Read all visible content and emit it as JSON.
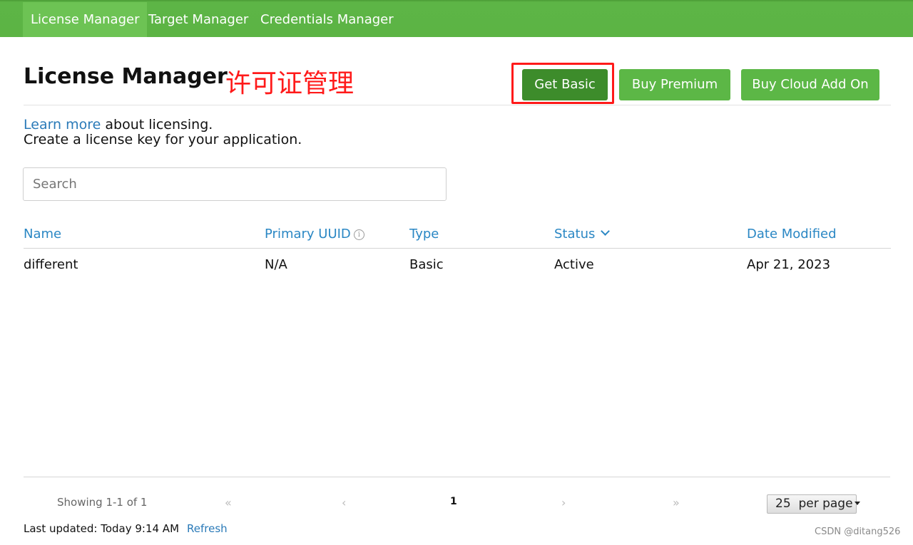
{
  "nav": {
    "tabs": [
      {
        "label": "License Manager",
        "active": true
      },
      {
        "label": "Target Manager",
        "active": false
      },
      {
        "label": "Credentials Manager",
        "active": false
      }
    ]
  },
  "header": {
    "title": "License Manager",
    "annotation": "许可证管理",
    "buttons": {
      "get_basic": "Get Basic",
      "buy_premium": "Buy Premium",
      "buy_cloud_add_on": "Buy Cloud Add On"
    }
  },
  "intro": {
    "learn_more_link": "Learn more",
    "learn_more_suffix": " about licensing.",
    "line2": "Create a license key for your application."
  },
  "search": {
    "placeholder": "Search",
    "value": ""
  },
  "table": {
    "columns": [
      {
        "label": "Name"
      },
      {
        "label": "Primary UUID",
        "icon": "info-icon"
      },
      {
        "label": "Type"
      },
      {
        "label": "Status",
        "icon": "chevron-down-icon",
        "sorted": "desc"
      },
      {
        "label": "Date Modified"
      }
    ],
    "rows": [
      [
        "different",
        "N/A",
        "Basic",
        "Active",
        "Apr 21, 2023"
      ]
    ]
  },
  "pagination": {
    "showing": "Showing 1-1 of 1",
    "first": "«",
    "prev": "‹",
    "current_page": "1",
    "next": "›",
    "last": "»",
    "per_page_value": "25",
    "per_page_label": "per page"
  },
  "footer": {
    "last_updated": "Last updated: Today 9:14 AM",
    "refresh": "Refresh"
  },
  "watermark": "CSDN @ditang526",
  "colors": {
    "nav_bar": "#5cb444",
    "button_green": "#5cb746",
    "button_dark": "#3d8c2b",
    "link_blue": "#2a87c4",
    "annotation_red": "#ff1a1a"
  }
}
